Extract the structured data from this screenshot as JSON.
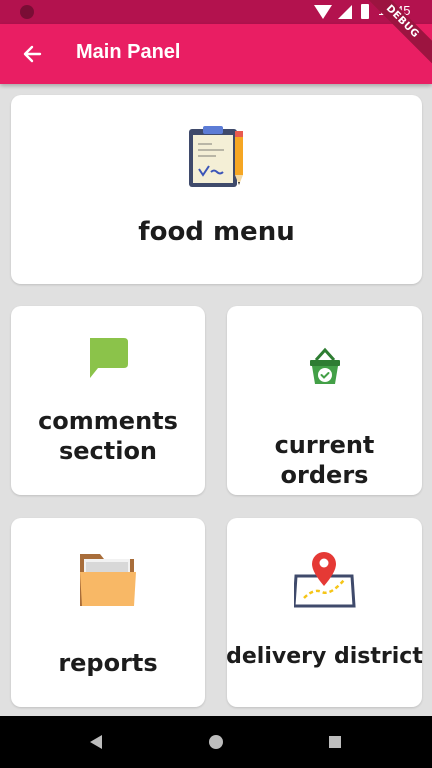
{
  "status_bar": {
    "time": "10:45"
  },
  "app_bar": {
    "title": "Main Panel",
    "debug_badge": "DEBUG"
  },
  "cards": {
    "food_menu": {
      "label": "food menu",
      "icon": "clipboard-icon"
    },
    "comments_section": {
      "label_line1": "comments",
      "label_line2": "section",
      "icon": "comment-icon"
    },
    "current_orders": {
      "label": "current orders",
      "icon": "basket-icon"
    },
    "reports": {
      "label": "reports",
      "icon": "folder-icon"
    },
    "delivery_district": {
      "label": "delivery district",
      "icon": "map-pin-icon"
    }
  },
  "colors": {
    "status_bar": "#b3124e",
    "app_bar": "#e91e63",
    "background": "#e0e0e0"
  }
}
